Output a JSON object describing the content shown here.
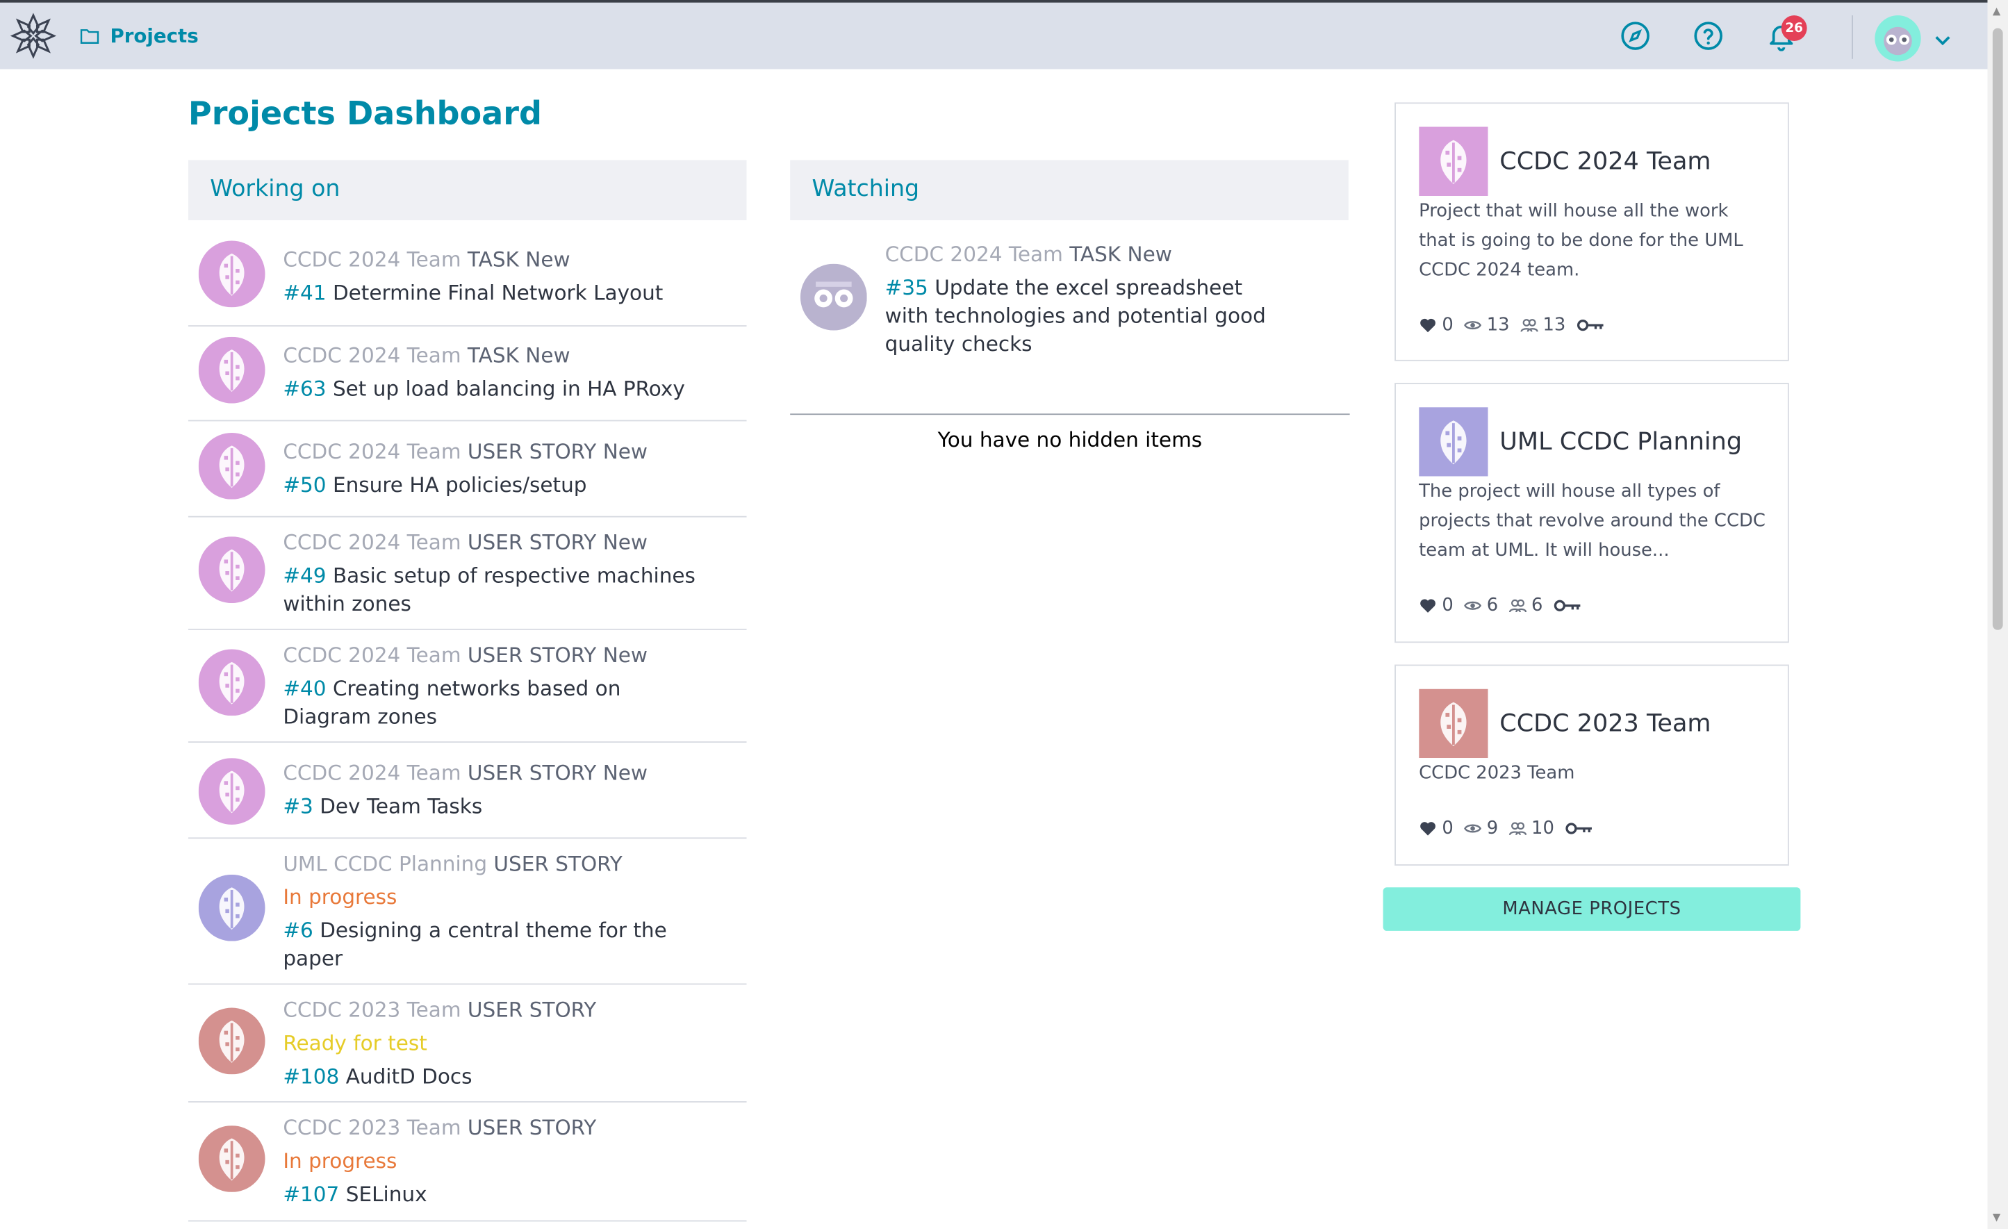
{
  "header": {
    "breadcrumb": "Projects",
    "notifications_count": "26"
  },
  "page_title": "Projects Dashboard",
  "working_on": {
    "title": "Working on",
    "items": [
      {
        "project": "CCDC 2024 Team",
        "type": "TASK",
        "status": "New",
        "ref": "#41",
        "subject": "Determine Final Network Layout"
      },
      {
        "project": "CCDC 2024 Team",
        "type": "TASK",
        "status": "New",
        "ref": "#63",
        "subject": "Set up load balancing in HA PRoxy"
      },
      {
        "project": "CCDC 2024 Team",
        "type": "USER STORY",
        "status": "New",
        "ref": "#50",
        "subject": "Ensure HA policies/setup"
      },
      {
        "project": "CCDC 2024 Team",
        "type": "USER STORY",
        "status": "New",
        "ref": "#49",
        "subject": "Basic setup of respective machines within zones"
      },
      {
        "project": "CCDC 2024 Team",
        "type": "USER STORY",
        "status": "New",
        "ref": "#40",
        "subject": "Creating networks based on Diagram zones"
      },
      {
        "project": "CCDC 2024 Team",
        "type": "USER STORY",
        "status": "New",
        "ref": "#3",
        "subject": "Dev Team Tasks"
      },
      {
        "project": "UML CCDC Planning",
        "type": "USER STORY",
        "status": "In progress",
        "ref": "#6",
        "subject": "Designing a central theme for the paper"
      },
      {
        "project": "CCDC 2023 Team",
        "type": "USER STORY",
        "status": "Ready for test",
        "ref": "#108",
        "subject": "AuditD Docs"
      },
      {
        "project": "CCDC 2023 Team",
        "type": "USER STORY",
        "status": "In progress",
        "ref": "#107",
        "subject": "SELinux"
      }
    ]
  },
  "watching": {
    "title": "Watching",
    "items": [
      {
        "project": "CCDC 2024 Team",
        "type": "TASK",
        "status": "New",
        "ref": "#35",
        "subject": "Update the excel spreadsheet with technologies and potential good quality checks"
      }
    ],
    "empty_hidden": "You have no hidden items"
  },
  "projects": [
    {
      "name": "CCDC 2024 Team",
      "description": "Project that will house all the work that is going to be done for the UML CCDC 2024 team.",
      "likes": "0",
      "watchers": "13",
      "members": "13",
      "color": "#d9a0dd"
    },
    {
      "name": "UML CCDC Planning",
      "description": "The project will house all types of projects that revolve around the CCDC team at UML. It will house...",
      "likes": "0",
      "watchers": "6",
      "members": "6",
      "color": "#a8a3df"
    },
    {
      "name": "CCDC 2023 Team",
      "description": "CCDC 2023 Team",
      "likes": "0",
      "watchers": "9",
      "members": "10",
      "color": "#d4918f"
    }
  ],
  "manage_button": "MANAGE PROJECTS",
  "colors": {
    "accent": "#008aa8",
    "in_progress": "#e8793a",
    "ready_for_test": "#e6cc28",
    "button": "#83eedd",
    "badge": "#e44057"
  },
  "icons": [
    "app-logo-icon",
    "folder-icon",
    "compass-icon",
    "help-icon",
    "bell-icon",
    "chevron-down-icon",
    "heart-icon",
    "eye-icon",
    "members-icon",
    "key-icon"
  ]
}
